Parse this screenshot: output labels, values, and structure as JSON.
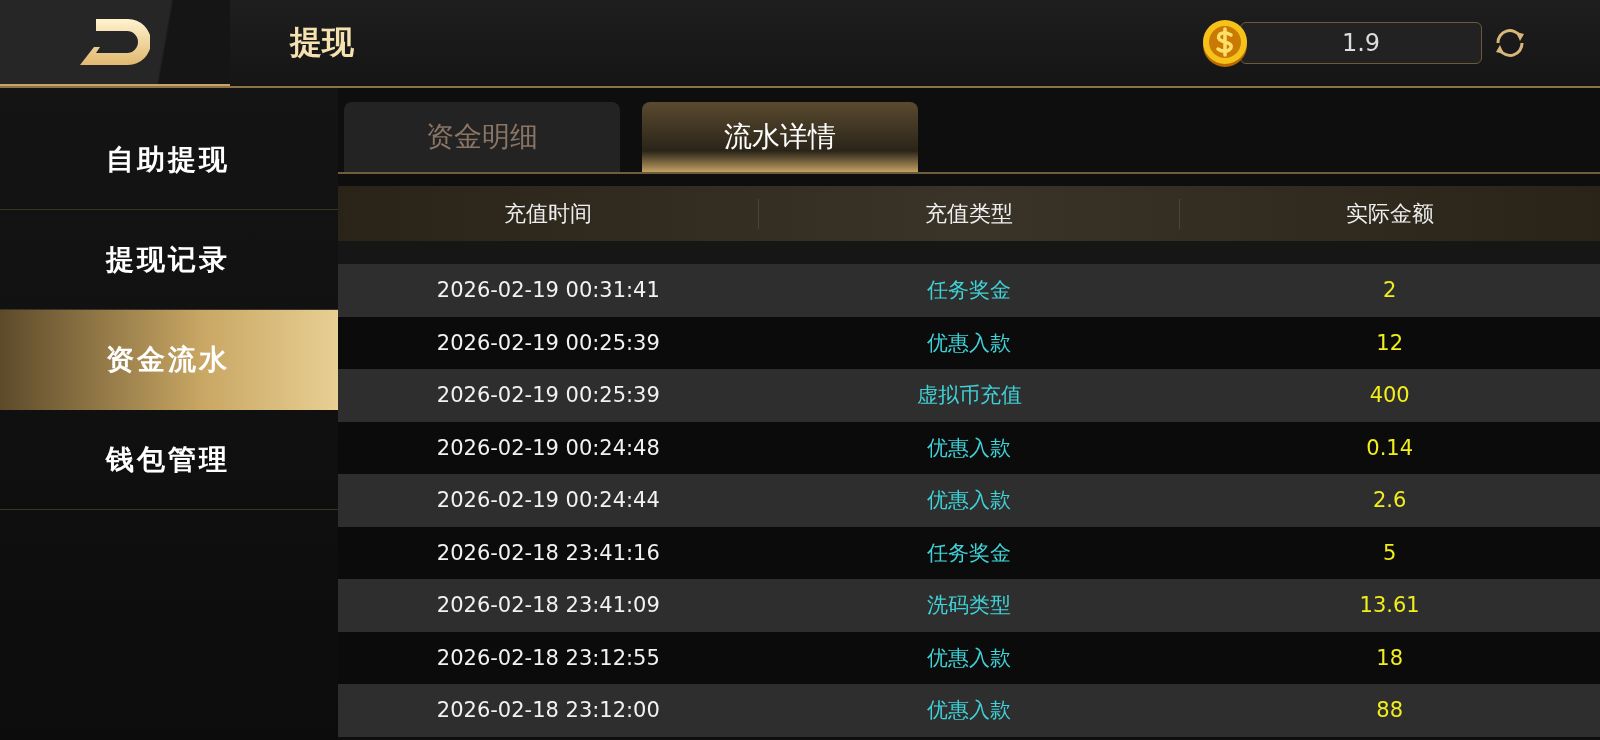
{
  "header": {
    "title": "提现",
    "balance": "1.9"
  },
  "sidebar": {
    "items": [
      {
        "label": "自助提现",
        "selected": false
      },
      {
        "label": "提现记录",
        "selected": false
      },
      {
        "label": "资金流水",
        "selected": true
      },
      {
        "label": "钱包管理",
        "selected": false
      }
    ]
  },
  "tabs": [
    {
      "label": "资金明细",
      "selected": false
    },
    {
      "label": "流水详情",
      "selected": true
    }
  ],
  "table": {
    "columns": [
      "充值时间",
      "充值类型",
      "实际金额"
    ],
    "rows": [
      [
        "2026-02-19 00:31:41",
        "任务奖金",
        "2"
      ],
      [
        "2026-02-19 00:25:39",
        "优惠入款",
        "12"
      ],
      [
        "2026-02-19 00:25:39",
        "虚拟币充值",
        "400"
      ],
      [
        "2026-02-19 00:24:48",
        "优惠入款",
        "0.14"
      ],
      [
        "2026-02-19 00:24:44",
        "优惠入款",
        "2.6"
      ],
      [
        "2026-02-18 23:41:16",
        "任务奖金",
        "5"
      ],
      [
        "2026-02-18 23:41:09",
        "洗码类型",
        "13.61"
      ],
      [
        "2026-02-18 23:12:55",
        "优惠入款",
        "18"
      ],
      [
        "2026-02-18 23:12:00",
        "优惠入款",
        "88"
      ]
    ]
  }
}
